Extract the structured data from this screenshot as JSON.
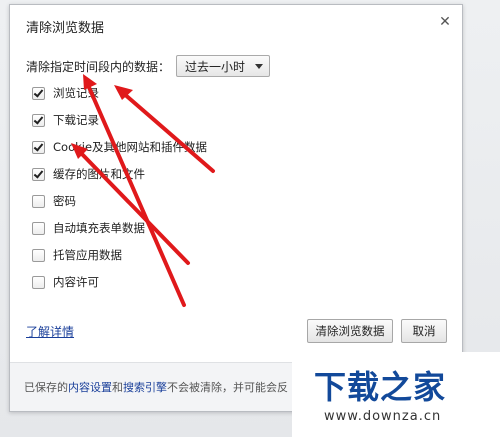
{
  "dialog": {
    "title": "清除浏览数据",
    "close_symbol": "✕",
    "range_label": "清除指定时间段内的数据：",
    "range_value": "过去一小时",
    "options": [
      {
        "label": "浏览记录",
        "checked": true
      },
      {
        "label": "下载记录",
        "checked": true
      },
      {
        "label": "Cookie及其他网站和插件数据",
        "checked": true
      },
      {
        "label": "缓存的图片和文件",
        "checked": true
      },
      {
        "label": "密码",
        "checked": false
      },
      {
        "label": "自动填充表单数据",
        "checked": false
      },
      {
        "label": "托管应用数据",
        "checked": false
      },
      {
        "label": "内容许可",
        "checked": false
      }
    ],
    "learn_more": "了解详情",
    "clear_button": "清除浏览数据",
    "cancel_button": "取消",
    "footer": {
      "pre": "已保存的",
      "link1": "内容设置",
      "mid": "和",
      "link2": "搜索引擎",
      "post": "不会被清除，并可能会反"
    }
  },
  "watermark": {
    "title": "下载之家",
    "url": "www.downza.cn"
  },
  "colors": {
    "arrow": "#e0191b",
    "link": "#1a3f9a",
    "watermark": "#12499a"
  }
}
